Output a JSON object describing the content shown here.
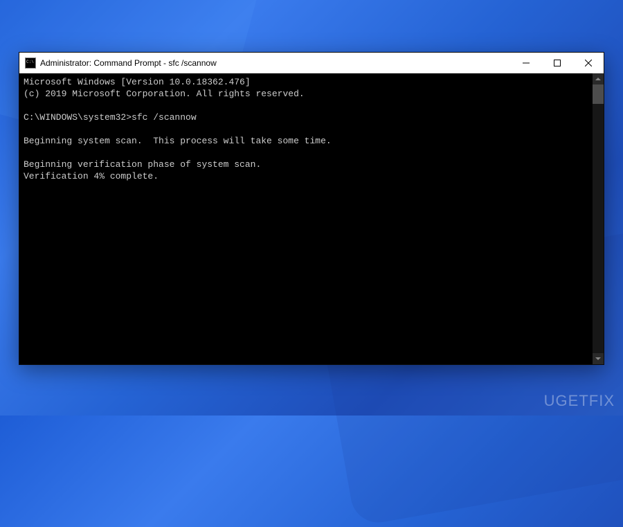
{
  "window": {
    "title": "Administrator: Command Prompt - sfc  /scannow"
  },
  "terminal": {
    "line1": "Microsoft Windows [Version 10.0.18362.476]",
    "line2": "(c) 2019 Microsoft Corporation. All rights reserved.",
    "blank1": "",
    "prompt": "C:\\WINDOWS\\system32>sfc /scannow",
    "blank2": "",
    "line3": "Beginning system scan.  This process will take some time.",
    "blank3": "",
    "line4": "Beginning verification phase of system scan.",
    "line5": "Verification 4% complete."
  },
  "watermark": "UGETFIX"
}
